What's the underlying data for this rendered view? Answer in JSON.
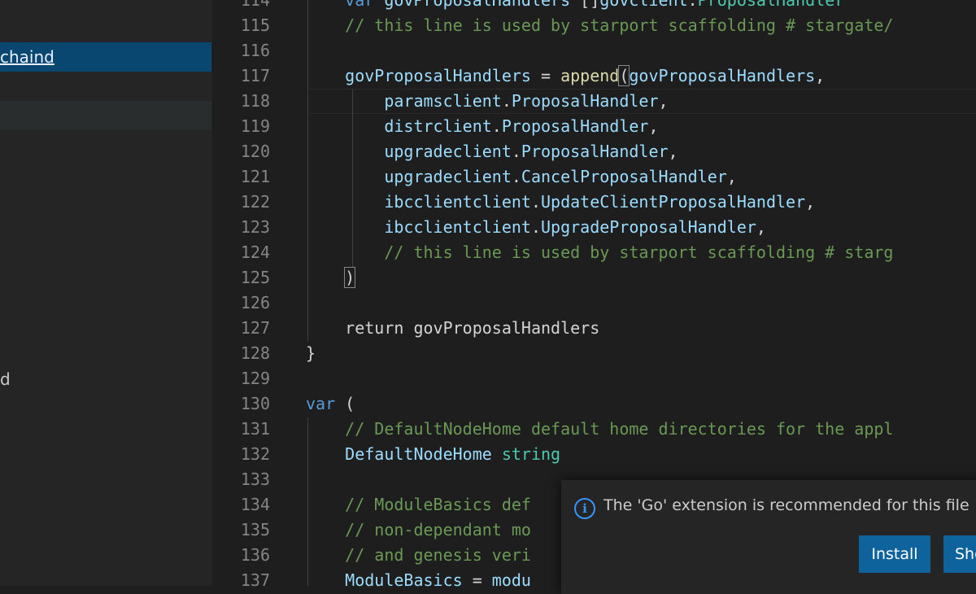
{
  "sidebar": {
    "items": [
      {
        "label": "chaind",
        "selected": true
      },
      {
        "label": "d"
      }
    ]
  },
  "editor": {
    "lines": [
      {
        "n": "114",
        "tokens": [
          {
            "t": "    "
          },
          {
            "t": "var",
            "c": "kw"
          },
          {
            "t": " "
          },
          {
            "t": "govProposalHandlers",
            "c": "id"
          },
          {
            "t": " []"
          },
          {
            "t": "govclient",
            "c": "id"
          },
          {
            "t": "."
          },
          {
            "t": "ProposalHandler",
            "c": "ty"
          }
        ]
      },
      {
        "n": "115",
        "tokens": [
          {
            "t": "    "
          },
          {
            "t": "// this line is used by starport scaffolding # stargate/",
            "c": "cm"
          }
        ]
      },
      {
        "n": "116",
        "tokens": []
      },
      {
        "n": "117",
        "tokens": [
          {
            "t": "    "
          },
          {
            "t": "govProposalHandlers",
            "c": "id"
          },
          {
            "t": " = "
          },
          {
            "t": "append",
            "c": "fn"
          },
          {
            "t": "(",
            "c": "bm"
          },
          {
            "t": "govProposalHandlers",
            "c": "id"
          },
          {
            "t": ","
          }
        ]
      },
      {
        "n": "118",
        "tokens": [
          {
            "t": "        "
          },
          {
            "t": "paramsclient",
            "c": "id"
          },
          {
            "t": "."
          },
          {
            "t": "ProposalHandler",
            "c": "id"
          },
          {
            "t": ","
          }
        ]
      },
      {
        "n": "119",
        "tokens": [
          {
            "t": "        "
          },
          {
            "t": "distrclient",
            "c": "id"
          },
          {
            "t": "."
          },
          {
            "t": "ProposalHandler",
            "c": "id"
          },
          {
            "t": ","
          }
        ]
      },
      {
        "n": "120",
        "tokens": [
          {
            "t": "        "
          },
          {
            "t": "upgradeclient",
            "c": "id"
          },
          {
            "t": "."
          },
          {
            "t": "ProposalHandler",
            "c": "id"
          },
          {
            "t": ","
          }
        ]
      },
      {
        "n": "121",
        "tokens": [
          {
            "t": "        "
          },
          {
            "t": "upgradeclient",
            "c": "id"
          },
          {
            "t": "."
          },
          {
            "t": "CancelProposalHandler",
            "c": "id"
          },
          {
            "t": ","
          }
        ]
      },
      {
        "n": "122",
        "tokens": [
          {
            "t": "        "
          },
          {
            "t": "ibcclientclient",
            "c": "id"
          },
          {
            "t": "."
          },
          {
            "t": "UpdateClientProposalHandler",
            "c": "id"
          },
          {
            "t": ","
          }
        ]
      },
      {
        "n": "123",
        "tokens": [
          {
            "t": "        "
          },
          {
            "t": "ibcclientclient",
            "c": "id"
          },
          {
            "t": "."
          },
          {
            "t": "UpgradeProposalHandler",
            "c": "id"
          },
          {
            "t": ","
          }
        ]
      },
      {
        "n": "124",
        "tokens": [
          {
            "t": "        "
          },
          {
            "t": "// this line is used by starport scaffolding # starg",
            "c": "cm"
          }
        ]
      },
      {
        "n": "125",
        "tokens": [
          {
            "t": "    "
          },
          {
            "t": ")",
            "c": "bm"
          }
        ]
      },
      {
        "n": "126",
        "tokens": []
      },
      {
        "n": "127",
        "tokens": [
          {
            "t": "    "
          },
          {
            "t": "return",
            "c": "pn"
          },
          {
            "t": " "
          },
          {
            "t": "govProposalHandlers",
            "c": "pn"
          }
        ]
      },
      {
        "n": "128",
        "tokens": [
          {
            "t": "}"
          }
        ]
      },
      {
        "n": "129",
        "tokens": []
      },
      {
        "n": "130",
        "tokens": [
          {
            "t": "var",
            "c": "kw"
          },
          {
            "t": " ("
          }
        ]
      },
      {
        "n": "131",
        "tokens": [
          {
            "t": "    "
          },
          {
            "t": "// DefaultNodeHome default home directories for the appl",
            "c": "cm"
          }
        ]
      },
      {
        "n": "132",
        "tokens": [
          {
            "t": "    "
          },
          {
            "t": "DefaultNodeHome",
            "c": "id"
          },
          {
            "t": " "
          },
          {
            "t": "string",
            "c": "ty"
          }
        ]
      },
      {
        "n": "133",
        "tokens": []
      },
      {
        "n": "134",
        "tokens": [
          {
            "t": "    "
          },
          {
            "t": "// ModuleBasics def",
            "c": "cm"
          }
        ]
      },
      {
        "n": "135",
        "tokens": [
          {
            "t": "    "
          },
          {
            "t": "// non-dependant mo",
            "c": "cm"
          }
        ]
      },
      {
        "n": "136",
        "tokens": [
          {
            "t": "    "
          },
          {
            "t": "// and genesis veri",
            "c": "cm"
          }
        ]
      },
      {
        "n": "137",
        "tokens": [
          {
            "t": "    "
          },
          {
            "t": "ModuleBasics",
            "c": "id"
          },
          {
            "t": " = "
          },
          {
            "t": "modu",
            "c": "id"
          }
        ]
      }
    ]
  },
  "notification": {
    "icon": "info-icon",
    "message": "The 'Go' extension is recommended for this file",
    "install_label": "Install",
    "second_label": "Sho"
  },
  "colors": {
    "accent": "#0e639c",
    "selection": "#094771",
    "comment": "#6a9955",
    "keyword": "#569cd6"
  }
}
